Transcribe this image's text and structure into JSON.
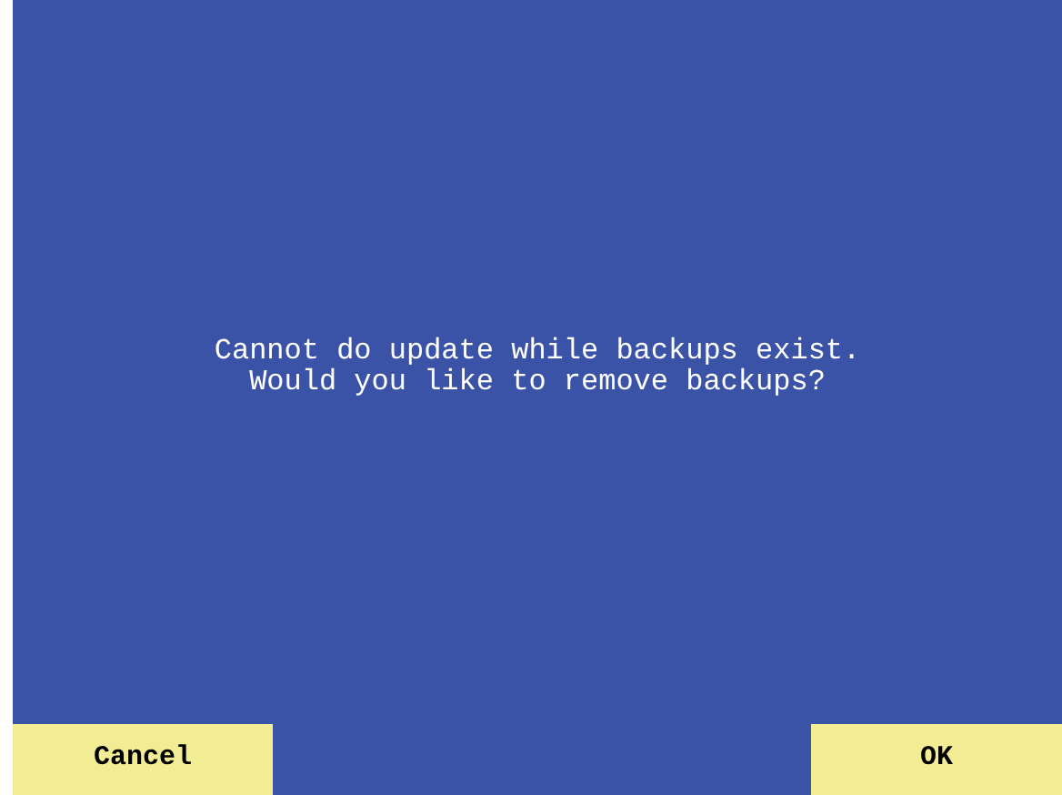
{
  "message": [
    "Cannot do update while backups exist.",
    "Would you like to remove backups?"
  ],
  "buttons": [
    {
      "label": "Cancel",
      "kind": "cancel"
    },
    {
      "label": "OK",
      "kind": "ok"
    }
  ]
}
